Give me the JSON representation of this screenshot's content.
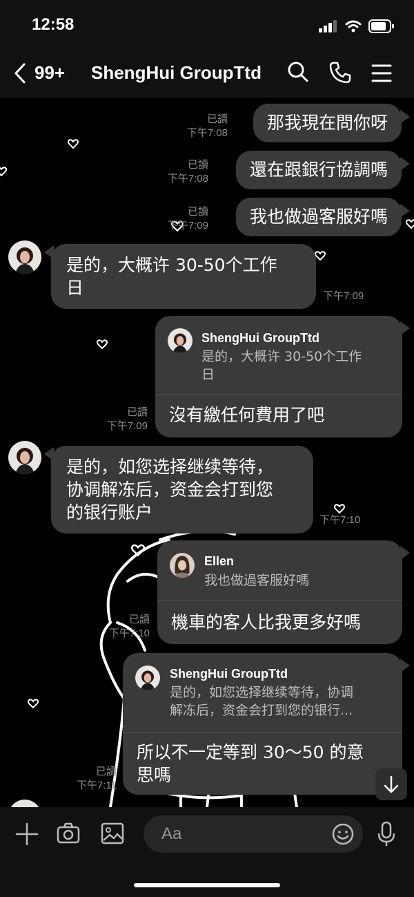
{
  "status_bar": {
    "time": "12:58"
  },
  "header": {
    "back_count": "99+",
    "title": "ShengHui GroupTtd"
  },
  "messages": {
    "m1": {
      "text": "那我現在問你呀",
      "read": "已讀",
      "time": "下午7:08"
    },
    "m2": {
      "text": "還在跟銀行協調嗎",
      "read": "已讀",
      "time": "下午7:08"
    },
    "m3": {
      "text": "我也做過客服好嗎",
      "read": "已讀",
      "time": "下午7:09"
    },
    "m4": {
      "line1": "是的，大概许 30-50个工作",
      "line2": "日",
      "time": "下午7:09"
    },
    "m5": {
      "quote_name": "ShengHui GroupTtd",
      "quote_line1": "是的，大概许 30-50个工作",
      "quote_line2": "日",
      "text": "沒有繳任何費用了吧",
      "read": "已讀",
      "time": "下午7:09"
    },
    "m6": {
      "line1": "是的，如您选择继续等待，",
      "line2": "协调解冻后，资金会打到您",
      "line3": "的银行账户",
      "time": "下午7:10"
    },
    "m7": {
      "quote_name": "Ellen",
      "quote_line1": "我也做過客服好嗎",
      "text": "機車的客人比我更多好嗎",
      "read": "已讀",
      "time": "下午7:10"
    },
    "m8": {
      "quote_name": "ShengHui GroupTtd",
      "quote_line1": "是的，如您选择继续等待，协调",
      "quote_line2": "解冻后，资金会打到您的银行...",
      "line1": "所以不一定等到 30～50 的意",
      "line2": "思嗎",
      "read": "已讀",
      "time": "下午7:11"
    }
  },
  "input": {
    "placeholder": "Aa"
  },
  "colors": {
    "bubble": "#3a3a3a",
    "background": "#000000",
    "meta": "#8e8e8e"
  }
}
